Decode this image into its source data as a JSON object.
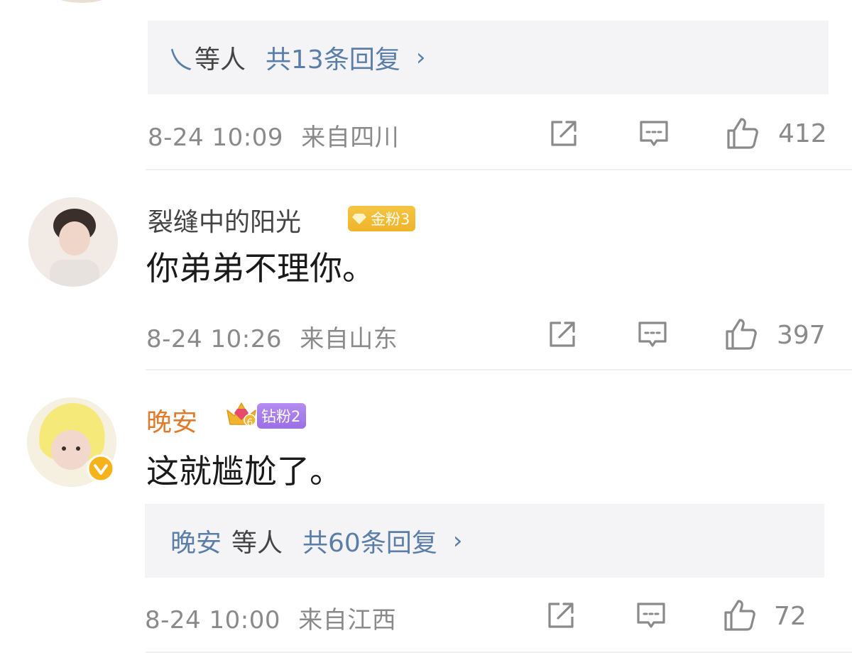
{
  "comments": [
    {
      "reply_summary": {
        "names": "乀",
        "others": "等人",
        "count": "共13条回复",
        "chevron": "›"
      },
      "time": "8-24 10:09",
      "location": "来自四川",
      "likes": "412"
    },
    {
      "username": "裂缝中的阳光",
      "badge": "金粉3",
      "content": "你弟弟不理你。",
      "time": "8-24 10:26",
      "location": "来自山东",
      "likes": "397"
    },
    {
      "username": "晚安",
      "badge": "钻粉2",
      "badge_level": "6",
      "content": "这就尴尬了。",
      "reply_summary": {
        "names": "晚安",
        "others": "等人",
        "count": "共60条回复",
        "chevron": "›"
      },
      "time": "8-24 10:00",
      "location": "来自江西",
      "likes": "72"
    }
  ],
  "icons": {
    "share": "share-icon",
    "comment": "comment-icon",
    "like": "thumbs-up-icon",
    "verified": "verified-badge-icon"
  },
  "colors": {
    "link_blue": "#5a7ea8",
    "username_orange": "#e07b2c",
    "meta_gray": "#8a8a8a",
    "reply_bg": "#f4f4f6",
    "gold_badge": "#f2bb35",
    "diamond_badge": "#a77deb"
  }
}
